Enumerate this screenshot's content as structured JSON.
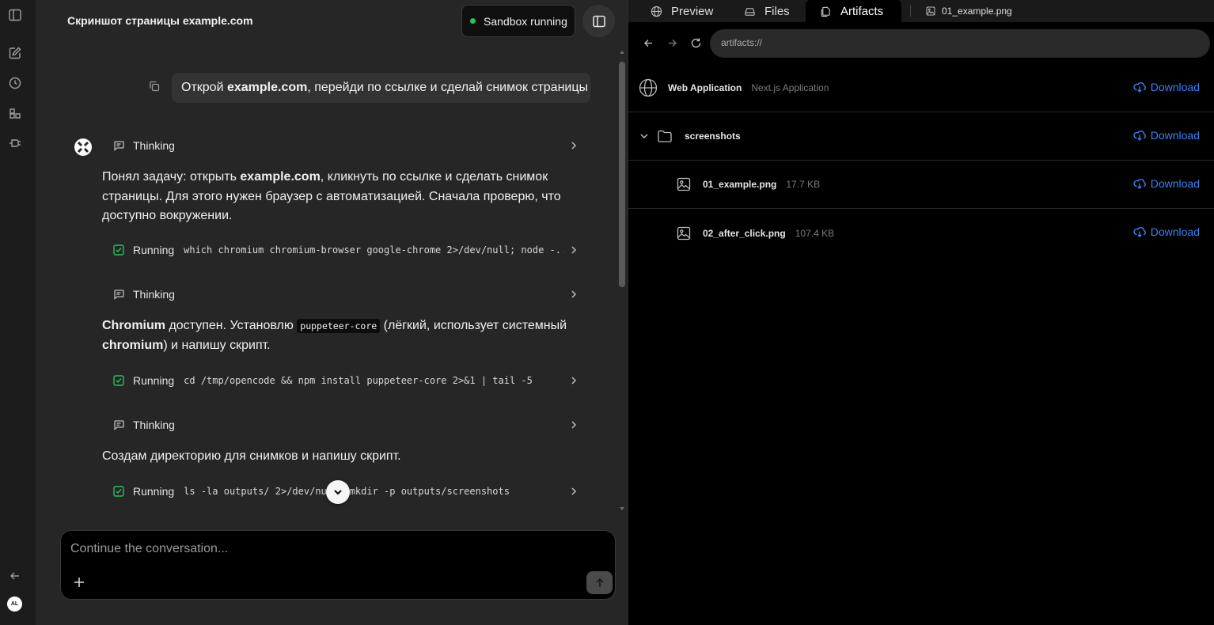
{
  "chat": {
    "title": "Скриншот страницы example.com",
    "sandbox_status": "Sandbox running",
    "user_message_pre": "Открой ",
    "user_message_bold": "example.com",
    "user_message_post": ", перейди по ссылке и сделай снимок страницы",
    "steps": [
      {
        "type": "thinking",
        "label": "Thinking"
      },
      {
        "type": "running",
        "label": "Running",
        "command": "which chromium chromium-browser google-chrome 2>/dev/null; node -..."
      },
      {
        "type": "thinking",
        "label": "Thinking"
      },
      {
        "type": "running",
        "label": "Running",
        "command": "cd /tmp/opencode && npm install puppeteer-core 2>&1 | tail -5"
      },
      {
        "type": "thinking",
        "label": "Thinking"
      },
      {
        "type": "running",
        "label": "Running",
        "command": "ls -la outputs/ 2>/dev/null; mkdir -p outputs/screenshots"
      }
    ],
    "para1_a": "Понял задачу: открыть ",
    "para1_bold": "example.com",
    "para1_b": ", кликнуть по ссылке и сделать снимок страницы. Для этого нужен браузер с автоматизацией. Сначала проверю, что доступно вокружении.",
    "para2_bold1": "Chromium",
    "para2_a": " доступен. Установлю ",
    "para2_code": "puppeteer-core",
    "para2_b": " (лёгкий, использует системный ",
    "para2_bold2": "chromium",
    "para2_c": ") и напишу скрипт.",
    "para3": "Создам директорию для снимков и напишу скрипт.",
    "composer_placeholder": "Continue the conversation..."
  },
  "sidebar": {
    "avatar_initials": "AL"
  },
  "right_panel": {
    "tabs": [
      "Preview",
      "Files",
      "Artifacts"
    ],
    "active_tab": "Artifacts",
    "file_tab": "01_example.png",
    "url": "artifacts://",
    "items": [
      {
        "name": "Web Application",
        "meta": "Next.js Application",
        "download": "Download",
        "icon": "globe-icon"
      },
      {
        "name": "screenshots",
        "meta": "",
        "download": "Download",
        "icon": "folder-icon"
      },
      {
        "name": "01_example.png",
        "meta": "17.7 KB",
        "download": "Download",
        "icon": "image-icon"
      },
      {
        "name": "02_after_click.png",
        "meta": "107.4 KB",
        "download": "Download",
        "icon": "image-icon"
      }
    ]
  },
  "colors": {
    "accent_blue": "#3b82f6",
    "status_green": "#22c55e",
    "success_check": "#22c55e"
  }
}
